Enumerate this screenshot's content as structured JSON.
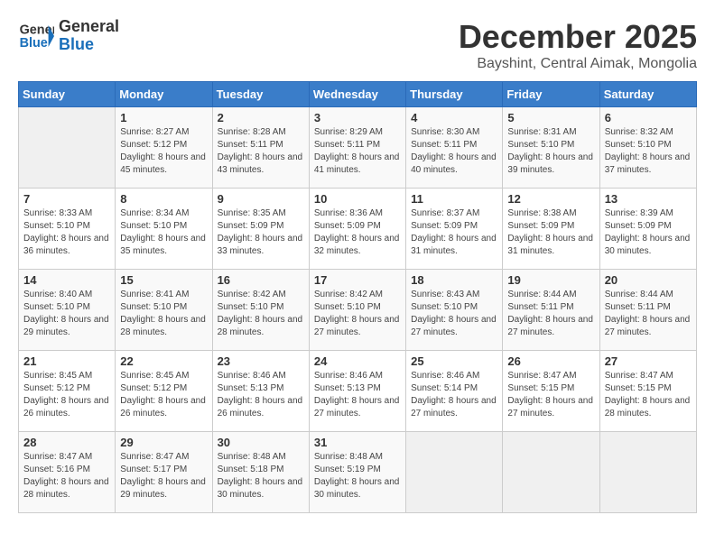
{
  "logo": {
    "line1": "General",
    "line2": "Blue"
  },
  "title": {
    "month": "December 2025",
    "location": "Bayshint, Central Aimak, Mongolia"
  },
  "header": {
    "days": [
      "Sunday",
      "Monday",
      "Tuesday",
      "Wednesday",
      "Thursday",
      "Friday",
      "Saturday"
    ]
  },
  "weeks": [
    [
      {
        "day": "",
        "sunrise": "",
        "sunset": "",
        "daylight": ""
      },
      {
        "day": "1",
        "sunrise": "Sunrise: 8:27 AM",
        "sunset": "Sunset: 5:12 PM",
        "daylight": "Daylight: 8 hours and 45 minutes."
      },
      {
        "day": "2",
        "sunrise": "Sunrise: 8:28 AM",
        "sunset": "Sunset: 5:11 PM",
        "daylight": "Daylight: 8 hours and 43 minutes."
      },
      {
        "day": "3",
        "sunrise": "Sunrise: 8:29 AM",
        "sunset": "Sunset: 5:11 PM",
        "daylight": "Daylight: 8 hours and 41 minutes."
      },
      {
        "day": "4",
        "sunrise": "Sunrise: 8:30 AM",
        "sunset": "Sunset: 5:11 PM",
        "daylight": "Daylight: 8 hours and 40 minutes."
      },
      {
        "day": "5",
        "sunrise": "Sunrise: 8:31 AM",
        "sunset": "Sunset: 5:10 PM",
        "daylight": "Daylight: 8 hours and 39 minutes."
      },
      {
        "day": "6",
        "sunrise": "Sunrise: 8:32 AM",
        "sunset": "Sunset: 5:10 PM",
        "daylight": "Daylight: 8 hours and 37 minutes."
      }
    ],
    [
      {
        "day": "7",
        "sunrise": "Sunrise: 8:33 AM",
        "sunset": "Sunset: 5:10 PM",
        "daylight": "Daylight: 8 hours and 36 minutes."
      },
      {
        "day": "8",
        "sunrise": "Sunrise: 8:34 AM",
        "sunset": "Sunset: 5:10 PM",
        "daylight": "Daylight: 8 hours and 35 minutes."
      },
      {
        "day": "9",
        "sunrise": "Sunrise: 8:35 AM",
        "sunset": "Sunset: 5:09 PM",
        "daylight": "Daylight: 8 hours and 33 minutes."
      },
      {
        "day": "10",
        "sunrise": "Sunrise: 8:36 AM",
        "sunset": "Sunset: 5:09 PM",
        "daylight": "Daylight: 8 hours and 32 minutes."
      },
      {
        "day": "11",
        "sunrise": "Sunrise: 8:37 AM",
        "sunset": "Sunset: 5:09 PM",
        "daylight": "Daylight: 8 hours and 31 minutes."
      },
      {
        "day": "12",
        "sunrise": "Sunrise: 8:38 AM",
        "sunset": "Sunset: 5:09 PM",
        "daylight": "Daylight: 8 hours and 31 minutes."
      },
      {
        "day": "13",
        "sunrise": "Sunrise: 8:39 AM",
        "sunset": "Sunset: 5:09 PM",
        "daylight": "Daylight: 8 hours and 30 minutes."
      }
    ],
    [
      {
        "day": "14",
        "sunrise": "Sunrise: 8:40 AM",
        "sunset": "Sunset: 5:10 PM",
        "daylight": "Daylight: 8 hours and 29 minutes."
      },
      {
        "day": "15",
        "sunrise": "Sunrise: 8:41 AM",
        "sunset": "Sunset: 5:10 PM",
        "daylight": "Daylight: 8 hours and 28 minutes."
      },
      {
        "day": "16",
        "sunrise": "Sunrise: 8:42 AM",
        "sunset": "Sunset: 5:10 PM",
        "daylight": "Daylight: 8 hours and 28 minutes."
      },
      {
        "day": "17",
        "sunrise": "Sunrise: 8:42 AM",
        "sunset": "Sunset: 5:10 PM",
        "daylight": "Daylight: 8 hours and 27 minutes."
      },
      {
        "day": "18",
        "sunrise": "Sunrise: 8:43 AM",
        "sunset": "Sunset: 5:10 PM",
        "daylight": "Daylight: 8 hours and 27 minutes."
      },
      {
        "day": "19",
        "sunrise": "Sunrise: 8:44 AM",
        "sunset": "Sunset: 5:11 PM",
        "daylight": "Daylight: 8 hours and 27 minutes."
      },
      {
        "day": "20",
        "sunrise": "Sunrise: 8:44 AM",
        "sunset": "Sunset: 5:11 PM",
        "daylight": "Daylight: 8 hours and 27 minutes."
      }
    ],
    [
      {
        "day": "21",
        "sunrise": "Sunrise: 8:45 AM",
        "sunset": "Sunset: 5:12 PM",
        "daylight": "Daylight: 8 hours and 26 minutes."
      },
      {
        "day": "22",
        "sunrise": "Sunrise: 8:45 AM",
        "sunset": "Sunset: 5:12 PM",
        "daylight": "Daylight: 8 hours and 26 minutes."
      },
      {
        "day": "23",
        "sunrise": "Sunrise: 8:46 AM",
        "sunset": "Sunset: 5:13 PM",
        "daylight": "Daylight: 8 hours and 26 minutes."
      },
      {
        "day": "24",
        "sunrise": "Sunrise: 8:46 AM",
        "sunset": "Sunset: 5:13 PM",
        "daylight": "Daylight: 8 hours and 27 minutes."
      },
      {
        "day": "25",
        "sunrise": "Sunrise: 8:46 AM",
        "sunset": "Sunset: 5:14 PM",
        "daylight": "Daylight: 8 hours and 27 minutes."
      },
      {
        "day": "26",
        "sunrise": "Sunrise: 8:47 AM",
        "sunset": "Sunset: 5:15 PM",
        "daylight": "Daylight: 8 hours and 27 minutes."
      },
      {
        "day": "27",
        "sunrise": "Sunrise: 8:47 AM",
        "sunset": "Sunset: 5:15 PM",
        "daylight": "Daylight: 8 hours and 28 minutes."
      }
    ],
    [
      {
        "day": "28",
        "sunrise": "Sunrise: 8:47 AM",
        "sunset": "Sunset: 5:16 PM",
        "daylight": "Daylight: 8 hours and 28 minutes."
      },
      {
        "day": "29",
        "sunrise": "Sunrise: 8:47 AM",
        "sunset": "Sunset: 5:17 PM",
        "daylight": "Daylight: 8 hours and 29 minutes."
      },
      {
        "day": "30",
        "sunrise": "Sunrise: 8:48 AM",
        "sunset": "Sunset: 5:18 PM",
        "daylight": "Daylight: 8 hours and 30 minutes."
      },
      {
        "day": "31",
        "sunrise": "Sunrise: 8:48 AM",
        "sunset": "Sunset: 5:19 PM",
        "daylight": "Daylight: 8 hours and 30 minutes."
      },
      {
        "day": "",
        "sunrise": "",
        "sunset": "",
        "daylight": ""
      },
      {
        "day": "",
        "sunrise": "",
        "sunset": "",
        "daylight": ""
      },
      {
        "day": "",
        "sunrise": "",
        "sunset": "",
        "daylight": ""
      }
    ]
  ]
}
